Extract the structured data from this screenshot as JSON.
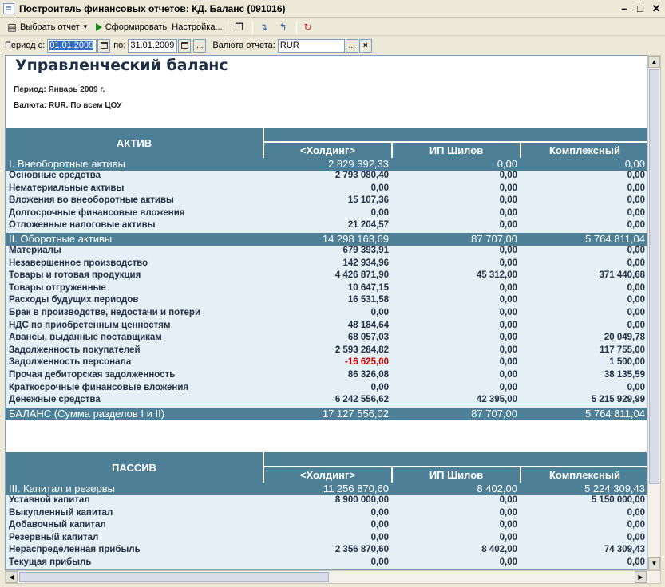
{
  "window": {
    "title": "Построитель финансовых отчетов: КД. Баланс (091016)"
  },
  "toolbar": {
    "choose_report": "Выбрать отчет",
    "generate": "Сформировать",
    "settings": "Настройка..."
  },
  "params": {
    "period_from_label": "Период с:",
    "period_from_value": "01.01.2009",
    "period_to_label": "по:",
    "period_to_value": "31.01.2009",
    "currency_label": "Валюта отчета:",
    "currency_value": "RUR",
    "ellipsis": "...",
    "clear": "×"
  },
  "report": {
    "title": "Управленческий баланс",
    "period_line": "Период: Январь 2009 г.",
    "currency_line": "Валюта: RUR.  По всем ЦОУ"
  },
  "active": {
    "section": "АКТИВ",
    "columns": [
      "<Холдинг>",
      "ИП Шилов",
      "Комплексный"
    ],
    "rows": [
      {
        "name": "I. Внеоборотные активы",
        "v": [
          "2 829 392,33",
          "0,00",
          "0,00"
        ],
        "group": true
      },
      {
        "name": "Основные средства",
        "v": [
          "2 793 080,40",
          "0,00",
          "0,00"
        ]
      },
      {
        "name": "Нематериальные активы",
        "v": [
          "0,00",
          "0,00",
          "0,00"
        ]
      },
      {
        "name": "Вложения во внеоборотные активы",
        "v": [
          "15 107,36",
          "0,00",
          "0,00"
        ]
      },
      {
        "name": "Долгосрочные финансовые вложения",
        "v": [
          "0,00",
          "0,00",
          "0,00"
        ]
      },
      {
        "name": "Отложенные налоговые активы",
        "v": [
          "21 204,57",
          "0,00",
          "0,00"
        ]
      },
      {
        "name": "II. Оборотные активы",
        "v": [
          "14 298 163,69",
          "87 707,00",
          "5 764 811,04"
        ],
        "group": true
      },
      {
        "name": "Материалы",
        "v": [
          "679 393,91",
          "0,00",
          "0,00"
        ]
      },
      {
        "name": "Незавершенное производство",
        "v": [
          "142 934,96",
          "0,00",
          "0,00"
        ]
      },
      {
        "name": "Товары и готовая продукция",
        "v": [
          "4 426 871,90",
          "45 312,00",
          "371 440,68"
        ]
      },
      {
        "name": "Товары отгруженные",
        "v": [
          "10 647,15",
          "0,00",
          "0,00"
        ]
      },
      {
        "name": "Расходы будущих периодов",
        "v": [
          "16 531,58",
          "0,00",
          "0,00"
        ]
      },
      {
        "name": "Брак в производстве, недостачи и потери",
        "v": [
          "0,00",
          "0,00",
          "0,00"
        ]
      },
      {
        "name": "НДС по приобретенным ценностям",
        "v": [
          "48 184,64",
          "0,00",
          "0,00"
        ]
      },
      {
        "name": "Авансы, выданные поставщикам",
        "v": [
          "68 057,03",
          "0,00",
          "20 049,78"
        ]
      },
      {
        "name": "Задолженность покупателей",
        "v": [
          "2 593 284,82",
          "0,00",
          "117 755,00"
        ]
      },
      {
        "name": "Задолженность персонала",
        "v": [
          "-16 625,00",
          "0,00",
          "1 500,00"
        ],
        "neg": true
      },
      {
        "name": "Прочая дебиторская задолженность",
        "v": [
          "86 326,08",
          "0,00",
          "38 135,59"
        ]
      },
      {
        "name": "Краткосрочные финансовые вложения",
        "v": [
          "0,00",
          "0,00",
          "0,00"
        ]
      },
      {
        "name": "Денежные средства",
        "v": [
          "6 242 556,62",
          "42 395,00",
          "5 215 929,99"
        ]
      },
      {
        "name": "БАЛАНС (Сумма разделов I и II)",
        "v": [
          "17 127 556,02",
          "87 707,00",
          "5 764 811,04"
        ],
        "group": true
      }
    ]
  },
  "passive": {
    "section": "ПАССИВ",
    "columns": [
      "<Холдинг>",
      "ИП Шилов",
      "Комплексный"
    ],
    "rows": [
      {
        "name": "III. Капитал и резервы",
        "v": [
          "11 256 870,60",
          "8 402,00",
          "5 224 309,43"
        ],
        "group": true
      },
      {
        "name": "Уставной капитал",
        "v": [
          "8 900 000,00",
          "0,00",
          "5 150 000,00"
        ]
      },
      {
        "name": "Выкупленный капитал",
        "v": [
          "0,00",
          "0,00",
          "0,00"
        ]
      },
      {
        "name": "Добавочный капитал",
        "v": [
          "0,00",
          "0,00",
          "0,00"
        ]
      },
      {
        "name": "Резервный капитал",
        "v": [
          "0,00",
          "0,00",
          "0,00"
        ]
      },
      {
        "name": "Нераспределенная прибыль",
        "v": [
          "2 356 870,60",
          "8 402,00",
          "74 309,43"
        ]
      },
      {
        "name": "Текущая прибыль",
        "v": [
          "0,00",
          "0,00",
          "0,00"
        ]
      }
    ]
  }
}
